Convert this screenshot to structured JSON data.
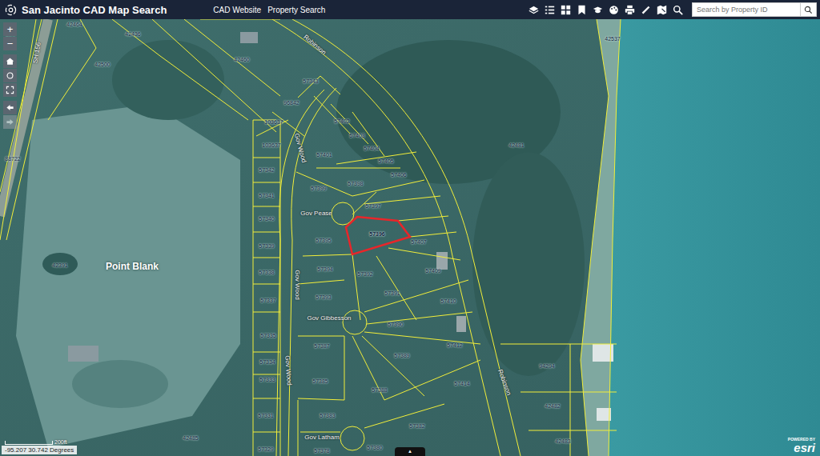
{
  "header": {
    "title": "San Jacinto CAD Map Search",
    "links": [
      {
        "label": "CAD Website"
      },
      {
        "label": "Property Search"
      }
    ],
    "search": {
      "placeholder": "Search by Property ID"
    }
  },
  "map_controls": {
    "zoom_in": "+",
    "zoom_out": "−",
    "back_disabled": false,
    "forward_disabled": true
  },
  "map": {
    "place_label": "Point Blank",
    "streets": [
      {
        "name": "Robinson"
      },
      {
        "name": "Gov Wood"
      },
      {
        "name": "Gov Pease"
      },
      {
        "name": "Gov Wood"
      },
      {
        "name": "Gov Gibbesson"
      },
      {
        "name": "Gov Wood"
      },
      {
        "name": "Gov Latham"
      },
      {
        "name": "Robinson"
      },
      {
        "name": "SH 156"
      }
    ],
    "parcels": [
      {
        "id": "42464",
        "selected": false
      },
      {
        "id": "42436",
        "selected": false
      },
      {
        "id": "504",
        "selected": false
      },
      {
        "id": "42537",
        "selected": false
      },
      {
        "id": "42500",
        "selected": false
      },
      {
        "id": "42460",
        "selected": false
      },
      {
        "id": "57343",
        "selected": false
      },
      {
        "id": "96842",
        "selected": false
      },
      {
        "id": "103637",
        "selected": false
      },
      {
        "id": "57402",
        "selected": false
      },
      {
        "id": "57403",
        "selected": false
      },
      {
        "id": "103637",
        "selected": false
      },
      {
        "id": "42481",
        "selected": false
      },
      {
        "id": "57404",
        "selected": false
      },
      {
        "id": "57401",
        "selected": false
      },
      {
        "id": "57405",
        "selected": false
      },
      {
        "id": "88722",
        "selected": false
      },
      {
        "id": "57342",
        "selected": false
      },
      {
        "id": "57406",
        "selected": false
      },
      {
        "id": "57398",
        "selected": false
      },
      {
        "id": "57399",
        "selected": false
      },
      {
        "id": "57341",
        "selected": false
      },
      {
        "id": "57397",
        "selected": false
      },
      {
        "id": "57340",
        "selected": false
      },
      {
        "id": "57396",
        "selected": true
      },
      {
        "id": "57395",
        "selected": false
      },
      {
        "id": "57407",
        "selected": false
      },
      {
        "id": "57339",
        "selected": false
      },
      {
        "id": "42391",
        "selected": false
      },
      {
        "id": "57394",
        "selected": false
      },
      {
        "id": "57409",
        "selected": false
      },
      {
        "id": "57338",
        "selected": false
      },
      {
        "id": "57392",
        "selected": false
      },
      {
        "id": "57391",
        "selected": false
      },
      {
        "id": "57393",
        "selected": false
      },
      {
        "id": "57337",
        "selected": false
      },
      {
        "id": "57410",
        "selected": false
      },
      {
        "id": "57390",
        "selected": false
      },
      {
        "id": "57335",
        "selected": false
      },
      {
        "id": "57412",
        "selected": false
      },
      {
        "id": "57387",
        "selected": false
      },
      {
        "id": "57389",
        "selected": false
      },
      {
        "id": "57334",
        "selected": false
      },
      {
        "id": "94294",
        "selected": false
      },
      {
        "id": "57333",
        "selected": false
      },
      {
        "id": "57385",
        "selected": false
      },
      {
        "id": "57414",
        "selected": false
      },
      {
        "id": "57388",
        "selected": false
      },
      {
        "id": "42482",
        "selected": false
      },
      {
        "id": "57331",
        "selected": false
      },
      {
        "id": "57383",
        "selected": false
      },
      {
        "id": "57382",
        "selected": false
      },
      {
        "id": "42485",
        "selected": false
      },
      {
        "id": "42483",
        "selected": false
      },
      {
        "id": "57380",
        "selected": false
      },
      {
        "id": "57329",
        "selected": false
      },
      {
        "id": "57378",
        "selected": false
      }
    ]
  },
  "status": {
    "scale": "200ft",
    "coordinates": "-95.207 30.742 Degrees",
    "panel_toggle": "▲",
    "attribution": {
      "prefix": "POWERED BY",
      "brand": "esri"
    }
  }
}
